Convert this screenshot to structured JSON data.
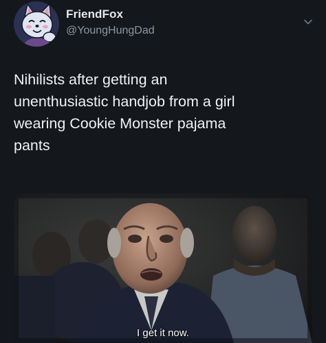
{
  "tweet": {
    "display_name": "FriendFox",
    "handle": "@YoungHungDad",
    "text": "Nihilists after getting an\nunenthusiastic handjob from a girl\nwearing Cookie Monster pajama\npants",
    "media_caption": "I get it now."
  },
  "icons": {
    "menu": "chevron-down-icon",
    "avatar": "fox-cartoon-avatar"
  },
  "colors": {
    "background": "#14171b",
    "primary_text": "#e7e9ea",
    "secondary_text": "#8b98a5"
  }
}
